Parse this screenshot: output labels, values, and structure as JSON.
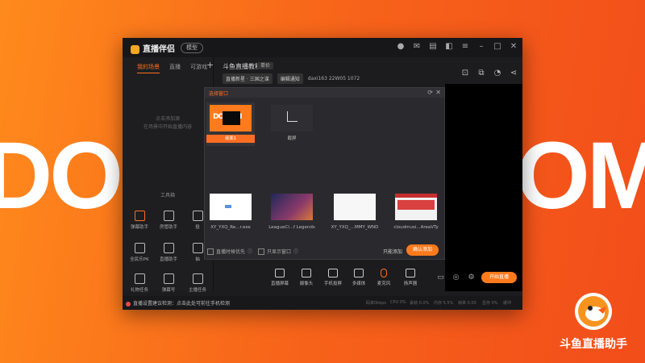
{
  "background": {
    "brand_word_left": "DOC",
    "brand_word_right": "OM",
    "corner_app_name": "斗鱼直播助手",
    "accent": "#ff7a1c"
  },
  "titlebar": {
    "brand": "直播伴侣",
    "pill": "模型",
    "icons": [
      "avatar-icon",
      "mail-icon",
      "notes-icon",
      "skin-icon",
      "menu-icon",
      "minimize-icon",
      "maximize-icon",
      "close-icon"
    ]
  },
  "sidebar": {
    "tabs": [
      "我的场景",
      "直播",
      "可游戏"
    ],
    "empty_line1": "点击添加源",
    "empty_line2": "在场景中开始直播内容",
    "tools_title": "工具箱",
    "tools": [
      {
        "label": "弹幕助手",
        "icon": "danmaku-icon"
      },
      {
        "label": "房管助手",
        "icon": "admin-icon"
      },
      {
        "label": "投",
        "icon": "cast-icon"
      },
      {
        "label": "全民乐PK",
        "icon": "pk-icon"
      },
      {
        "label": "直播助手",
        "icon": "assist-icon"
      },
      {
        "label": "抽",
        "icon": "draw-icon"
      },
      {
        "label": "礼物任务",
        "icon": "gift-icon"
      },
      {
        "label": "弹幕号",
        "icon": "calendar-icon"
      },
      {
        "label": "主播任务",
        "icon": "task-icon"
      },
      {
        "label": "",
        "icon": "shield-icon"
      },
      {
        "label": "",
        "icon": "phone-icon"
      }
    ]
  },
  "header": {
    "room_title": "斗鱼直播教程",
    "room_tag": "单价",
    "category": "直播新星 · 三国之谋",
    "edit_chip": "编辑通知",
    "stats": "daxi163   22W05   1072",
    "icons": [
      "lock-icon",
      "share-icon",
      "bell-icon",
      "share-alt-icon"
    ]
  },
  "dialog": {
    "title": "选择窗口",
    "sources": [
      {
        "caption": "桌面1",
        "kind": "orange",
        "thumb_text": "DOC  OM"
      },
      {
        "caption": "截屏",
        "kind": "crop"
      },
      {
        "caption": "XY_YXQ_Re...r.exe",
        "kind": "blank"
      },
      {
        "caption": "LeagueCl...f Legends",
        "kind": "game"
      },
      {
        "caption": "XY_YXQ_...MMY_WND",
        "kind": "white"
      },
      {
        "caption": "cloudmusi...AreaVTy",
        "kind": "web"
      }
    ],
    "checkbox1": "直播时候优先",
    "checkbox2": "只显示窗口",
    "cancel": "只能添加",
    "confirm": "确认添加"
  },
  "bottombar": {
    "items": [
      {
        "label": "直播屏幕",
        "icon": "screen-icon"
      },
      {
        "label": "摄像头",
        "icon": "camera-icon"
      },
      {
        "label": "手机投屏",
        "icon": "mobile-icon"
      },
      {
        "label": "多媒体",
        "icon": "media-icon"
      },
      {
        "label": "麦克风",
        "icon": "mic-icon"
      },
      {
        "label": "扬声器",
        "icon": "speaker-icon"
      }
    ],
    "start_button": "开始直播"
  },
  "status": {
    "warning": "直播设置建议检测：点击此处可前往手机检测",
    "stats": [
      "码率0kbps",
      "CPU 0%",
      "丢帧 0.0%",
      "内存 5.5%",
      "帧率 0.00",
      "显存 0%",
      "缓冲"
    ]
  }
}
